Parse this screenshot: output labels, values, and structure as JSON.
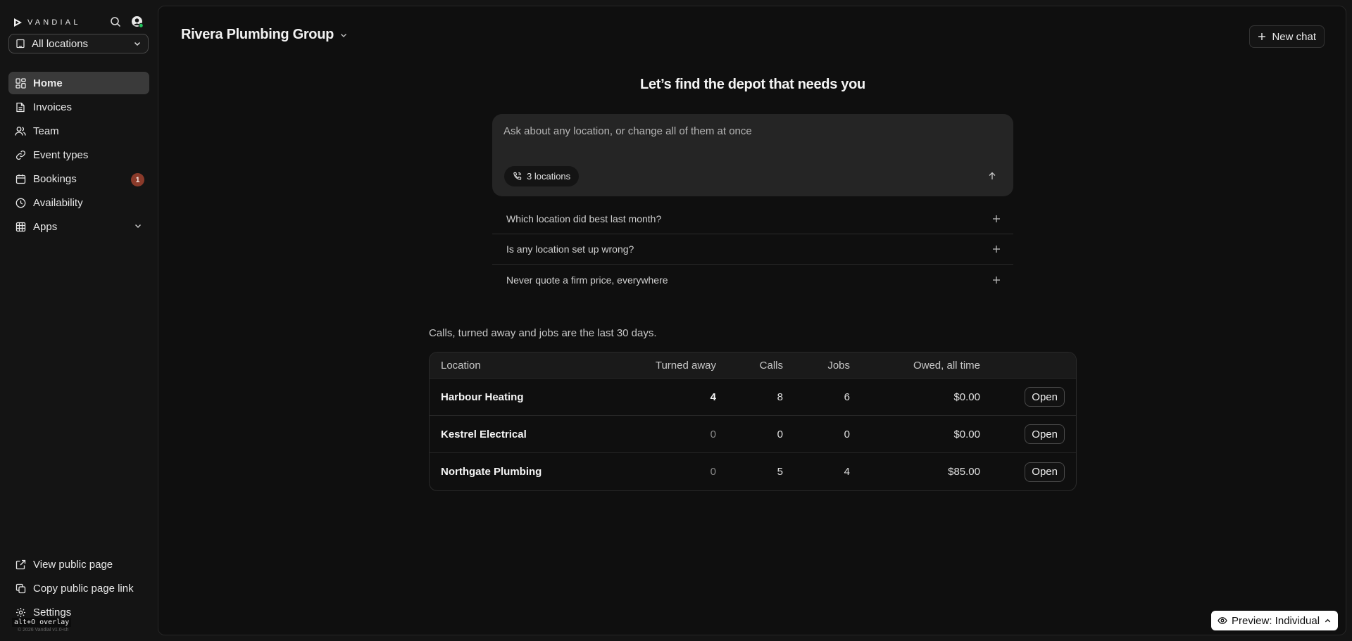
{
  "brand": {
    "name": "VANDIAL"
  },
  "location_select": {
    "label": "All locations"
  },
  "nav": {
    "items": [
      {
        "label": "Home",
        "icon": "grid-icon",
        "active": true
      },
      {
        "label": "Invoices",
        "icon": "file-icon"
      },
      {
        "label": "Team",
        "icon": "users-icon"
      },
      {
        "label": "Event types",
        "icon": "link-icon"
      },
      {
        "label": "Bookings",
        "icon": "calendar-icon",
        "badge": "1"
      },
      {
        "label": "Availability",
        "icon": "clock-icon"
      },
      {
        "label": "Apps",
        "icon": "table-grid-icon"
      }
    ],
    "bottom": [
      {
        "label": "View public page",
        "icon": "external-link-icon"
      },
      {
        "label": "Copy public page link",
        "icon": "copy-icon"
      },
      {
        "label": "Settings",
        "icon": "gear-icon"
      }
    ]
  },
  "overlay_tag": "alt+O overlay",
  "footer_tiny": "© 2026 Vandial v1.0-sh",
  "header": {
    "org_name": "Rivera Plumbing Group",
    "new_chat_label": "New chat"
  },
  "hero": {
    "headline": "Let’s find the depot that needs you",
    "ask_placeholder": "Ask about any location, or change all of them at once",
    "chip_label": "3 locations"
  },
  "suggestions": [
    "Which location did best last month?",
    "Is any location set up wrong?",
    "Never quote a firm price, everywhere"
  ],
  "table": {
    "note": "Calls, turned away and jobs are the last 30 days.",
    "headers": {
      "location": "Location",
      "turned_away": "Turned away",
      "calls": "Calls",
      "jobs": "Jobs",
      "owed": "Owed, all time"
    },
    "rows": [
      {
        "location": "Harbour Heating",
        "turned_away": "4",
        "calls": "8",
        "jobs": "6",
        "owed": "$0.00",
        "action": "Open"
      },
      {
        "location": "Kestrel Electrical",
        "turned_away": "0",
        "calls": "0",
        "jobs": "0",
        "owed": "$0.00",
        "action": "Open"
      },
      {
        "location": "Northgate Plumbing",
        "turned_away": "0",
        "calls": "5",
        "jobs": "4",
        "owed": "$85.00",
        "action": "Open"
      }
    ]
  },
  "preview": {
    "label": "Preview: Individual"
  },
  "colors": {
    "badge": "#8a3a2a",
    "status_online": "#22c55e"
  }
}
